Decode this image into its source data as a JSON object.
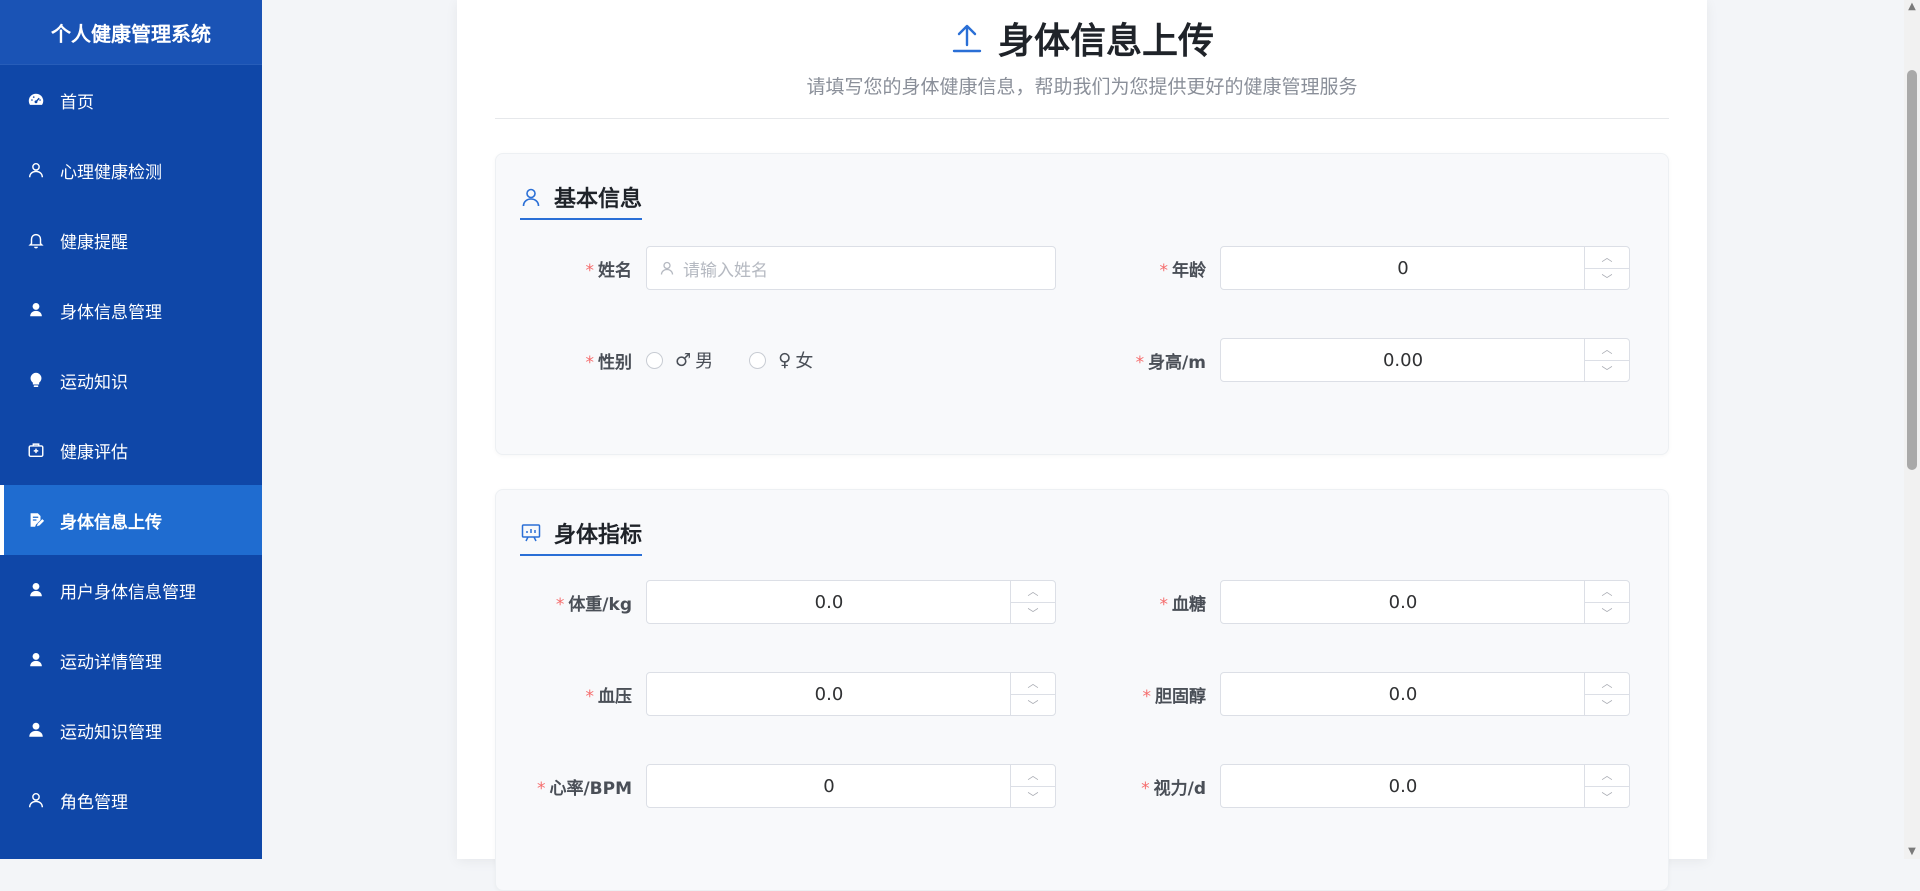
{
  "app": {
    "title": "个人健康管理系统"
  },
  "sidebar": {
    "items": [
      {
        "label": "首页",
        "icon": "dashboard-icon"
      },
      {
        "label": "心理健康检测",
        "icon": "user-icon"
      },
      {
        "label": "健康提醒",
        "icon": "bell-icon"
      },
      {
        "label": "身体信息管理",
        "icon": "user-icon"
      },
      {
        "label": "运动知识",
        "icon": "bulb-icon"
      },
      {
        "label": "健康评估",
        "icon": "medical-kit-icon"
      },
      {
        "label": "身体信息上传",
        "icon": "document-edit-icon",
        "active": true
      },
      {
        "label": "用户身体信息管理",
        "icon": "user-icon"
      },
      {
        "label": "运动详情管理",
        "icon": "user-icon"
      },
      {
        "label": "运动知识管理",
        "icon": "user-icon"
      },
      {
        "label": "角色管理",
        "icon": "user-icon"
      }
    ]
  },
  "page": {
    "title": "身体信息上传",
    "subtitle": "请填写您的身体健康信息，帮助我们为您提供更好的健康管理服务",
    "title_icon": "upload-icon"
  },
  "basic": {
    "title": "基本信息",
    "icon": "user-icon",
    "name_label": "姓名",
    "name_placeholder": "请输入姓名",
    "age_label": "年龄",
    "age_value": "0",
    "gender_label": "性别",
    "gender_options": [
      {
        "symbol": "♂",
        "label": "男"
      },
      {
        "symbol": "♀",
        "label": "女"
      }
    ],
    "height_label": "身高/m",
    "height_value": "0.00"
  },
  "metrics": {
    "title": "身体指标",
    "icon": "presentation-chart-icon",
    "weight_label": "体重/kg",
    "weight_value": "0.0",
    "sugar_label": "血糖",
    "sugar_value": "0.0",
    "pressure_label": "血压",
    "pressure_value": "0.0",
    "cholesterol_label": "胆固醇",
    "cholesterol_value": "0.0",
    "heart_label": "心率/BPM",
    "heart_value": "0",
    "vision_label": "视力/d",
    "vision_value": "0.0"
  },
  "form": {
    "required_mark": "*"
  },
  "colors": {
    "sidebar_bg": "#0f47a8",
    "sidebar_active": "#1f6cd0",
    "accent": "#2a6fd6",
    "required": "#f56c6c"
  }
}
